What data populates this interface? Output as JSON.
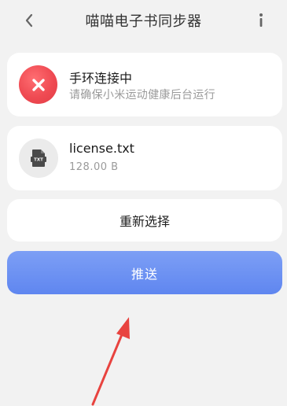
{
  "header": {
    "title": "喵喵电子书同步器",
    "back_icon": "chevron-left-icon",
    "info_icon": "info-icon"
  },
  "status": {
    "title": "手环连接中",
    "subtitle": "请确保小米运动健康后台运行",
    "icon": "close-icon",
    "color": "#ef4a52"
  },
  "file": {
    "name": "license.txt",
    "size": "128.00 B",
    "icon": "txt-file-icon",
    "icon_text": "TXT"
  },
  "actions": {
    "reselect_label": "重新选择",
    "push_label": "推送",
    "push_color": "#6a8ff2"
  },
  "annotation": {
    "arrow_color": "#e8433f"
  }
}
